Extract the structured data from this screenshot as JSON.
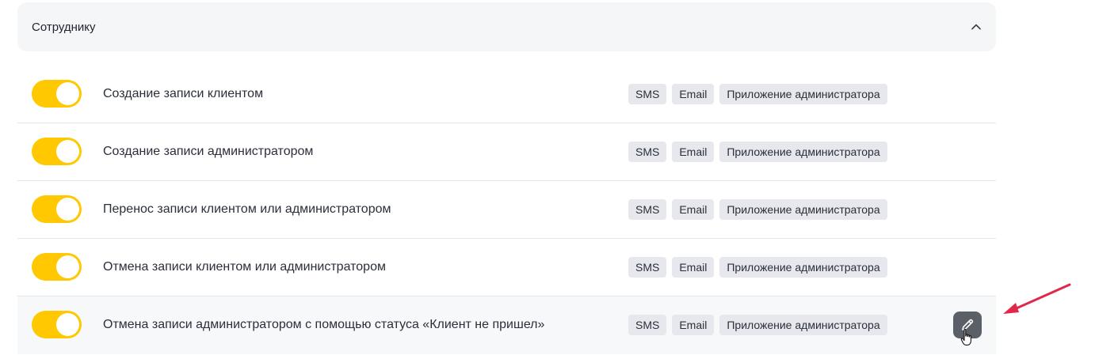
{
  "section": {
    "title": "Сотруднику",
    "collapse_icon": "chevron-up-icon"
  },
  "rows": [
    {
      "label": "Создание записи клиентом",
      "enabled": true,
      "tags": [
        "SMS",
        "Email",
        "Приложение администратора"
      ]
    },
    {
      "label": "Создание записи администратором",
      "enabled": true,
      "tags": [
        "SMS",
        "Email",
        "Приложение администратора"
      ]
    },
    {
      "label": "Перенос записи клиентом или администратором",
      "enabled": true,
      "tags": [
        "SMS",
        "Email",
        "Приложение администратора"
      ]
    },
    {
      "label": "Отмена записи клиентом или администратором",
      "enabled": true,
      "tags": [
        "SMS",
        "Email",
        "Приложение администратора"
      ]
    },
    {
      "label": "Отмена записи администратором с помощью статуса «Клиент не пришел»",
      "enabled": true,
      "tags": [
        "SMS",
        "Email",
        "Приложение администратора"
      ],
      "hovered": true,
      "edit_icon": "pencil-icon"
    }
  ],
  "colors": {
    "toggle_on": "#ffc800",
    "tag_bg": "#e6e8ee",
    "header_bg": "#f5f6f8",
    "edit_button": "#5b5f67",
    "annotation_arrow": "#e0284a"
  }
}
